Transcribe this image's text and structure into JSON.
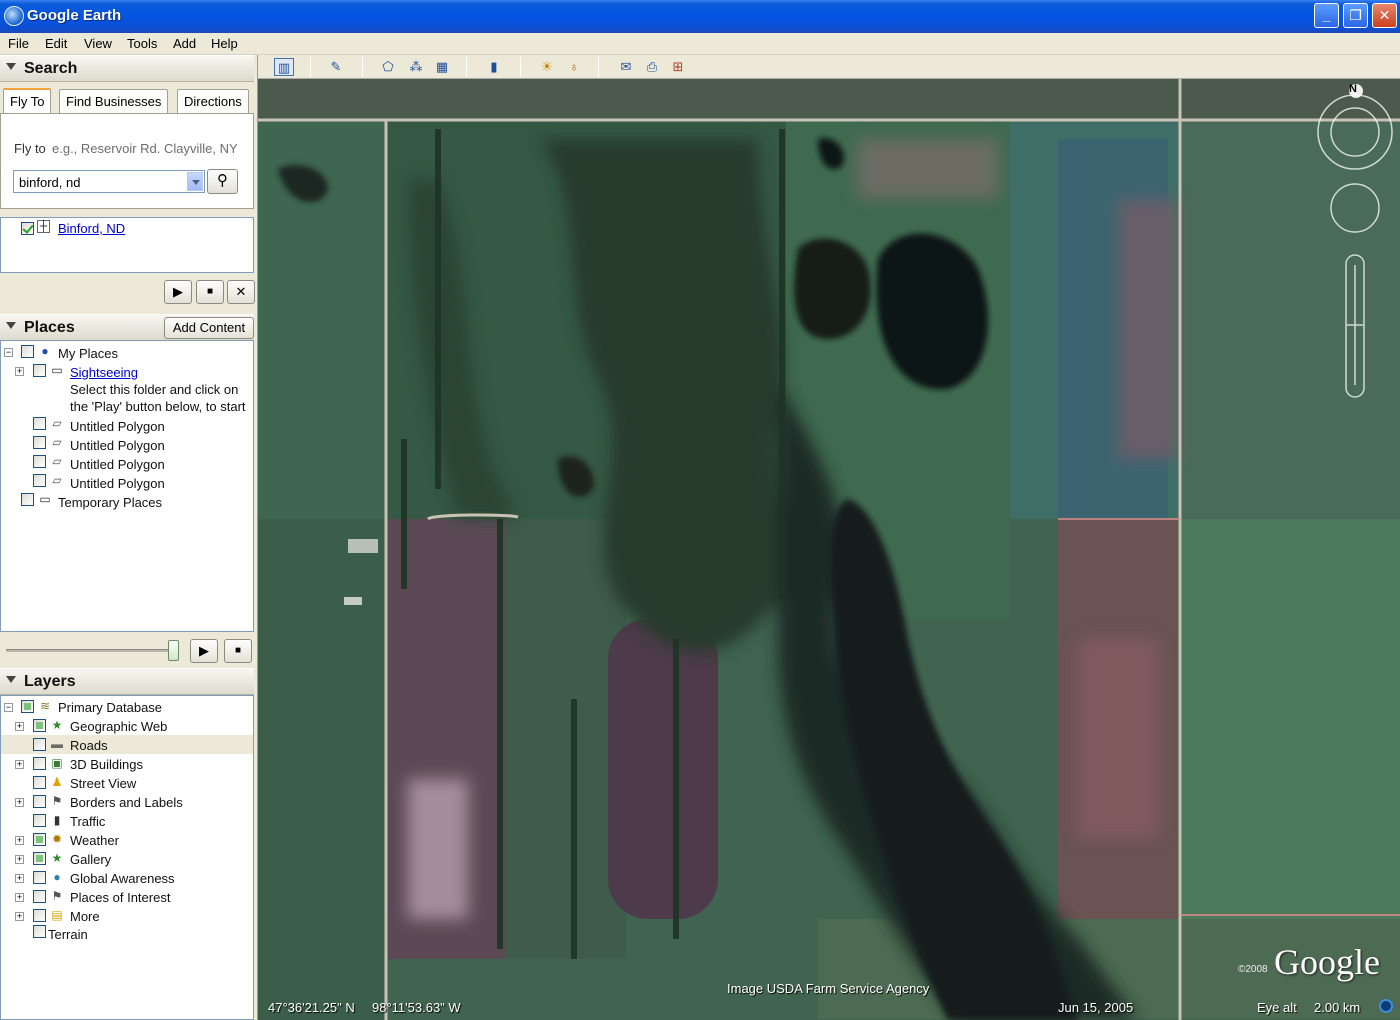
{
  "window": {
    "title": "Google Earth",
    "icon": "google-earth-globe-icon"
  },
  "menu": [
    "File",
    "Edit",
    "View",
    "Tools",
    "Add",
    "Help"
  ],
  "search": {
    "header": "Search",
    "tabs": [
      "Fly To",
      "Find Businesses",
      "Directions"
    ],
    "fly_to_label": "Fly to",
    "fly_to_hint": "e.g., Reservoir Rd. Clayville, NY",
    "query": "binford, nd",
    "result": "Binford, ND"
  },
  "places": {
    "header": "Places",
    "add_content": "Add Content",
    "items": [
      {
        "label": "My Places",
        "icon": "globe-icon"
      },
      {
        "label": "Sightseeing",
        "icon": "folder-icon"
      },
      {
        "label": "Untitled Polygon",
        "icon": "polygon-icon"
      },
      {
        "label": "Untitled Polygon",
        "icon": "polygon-icon"
      },
      {
        "label": "Untitled Polygon",
        "icon": "polygon-icon"
      },
      {
        "label": "Untitled Polygon",
        "icon": "polygon-icon"
      },
      {
        "label": "Temporary Places",
        "icon": "folder-icon"
      }
    ],
    "sightseeing_hint_1": "Select this folder and click on",
    "sightseeing_hint_2": "the 'Play' button below, to start"
  },
  "layers": {
    "header": "Layers",
    "root": "Primary Database",
    "items": [
      {
        "label": "Geographic Web",
        "icon": "star-icon",
        "state": "partial"
      },
      {
        "label": "Roads",
        "icon": "road-icon",
        "state": "unchecked"
      },
      {
        "label": "3D Buildings",
        "icon": "buildings-icon",
        "state": "unchecked"
      },
      {
        "label": "Street View",
        "icon": "pegman-icon",
        "state": "unchecked"
      },
      {
        "label": "Borders and Labels",
        "icon": "flag-icon",
        "state": "unchecked"
      },
      {
        "label": "Traffic",
        "icon": "traffic-light-icon",
        "state": "unchecked"
      },
      {
        "label": "Weather",
        "icon": "sun-icon",
        "state": "partial"
      },
      {
        "label": "Gallery",
        "icon": "star-icon",
        "state": "partial"
      },
      {
        "label": "Global Awareness",
        "icon": "globe-icon",
        "state": "unchecked"
      },
      {
        "label": "Places of Interest",
        "icon": "flag-icon",
        "state": "unchecked"
      },
      {
        "label": "More",
        "icon": "note-icon",
        "state": "unchecked"
      }
    ],
    "terrain": "Terrain"
  },
  "status": {
    "latitude": "47°36'21.25\" N",
    "longitude": "98°11'53.63\" W",
    "attribution": "Image USDA Farm Service Agency",
    "date": "Jun 15, 2005",
    "eye_alt_label": "Eye alt",
    "eye_alt_value": "2.00 km",
    "copyright_year": "©2008",
    "logo": "Google"
  },
  "compass_letter": "N"
}
